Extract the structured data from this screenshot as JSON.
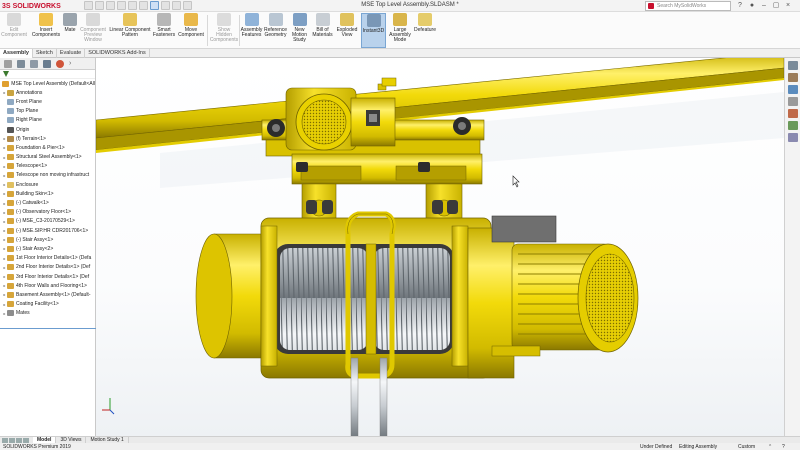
{
  "app": {
    "brand": "SOLIDWORKS",
    "logo_glyph": "3S"
  },
  "title_bar": {
    "document_title": "MSE Top Level Assembly.SLDASM *",
    "search_placeholder": "Search MySolidWorks",
    "icons": [
      "help-icon",
      "user-icon",
      "minimize-icon",
      "restore-icon",
      "close-icon"
    ]
  },
  "ribbon": {
    "commands": [
      {
        "label": "Edit\nComponent",
        "enabled": false,
        "icon": "edit-component-icon"
      },
      {
        "label": "Insert\nComponents",
        "enabled": true,
        "icon": "insert-components-icon"
      },
      {
        "label": "Mate",
        "enabled": true,
        "icon": "mate-icon"
      },
      {
        "label": "Component\nPreview\nWindow",
        "enabled": false,
        "icon": "preview-window-icon"
      },
      {
        "label": "Linear Component\nPattern",
        "enabled": true,
        "icon": "linear-pattern-icon"
      },
      {
        "label": "Smart\nFasteners",
        "enabled": true,
        "icon": "smart-fasteners-icon"
      },
      {
        "label": "Move\nComponent",
        "enabled": true,
        "icon": "move-component-icon"
      },
      {
        "label": "Show\nHidden\nComponents",
        "enabled": false,
        "icon": "show-hidden-icon"
      },
      {
        "label": "Assembly\nFeatures",
        "enabled": true,
        "icon": "assembly-features-icon"
      },
      {
        "label": "Reference\nGeometry",
        "enabled": true,
        "icon": "reference-geometry-icon"
      },
      {
        "label": "New\nMotion\nStudy",
        "enabled": true,
        "icon": "motion-study-icon"
      },
      {
        "label": "Bill of\nMaterials",
        "enabled": true,
        "icon": "bom-icon"
      },
      {
        "label": "Exploded\nView",
        "enabled": true,
        "icon": "exploded-view-icon"
      },
      {
        "label": "Instant3D",
        "enabled": true,
        "active": true,
        "icon": "instant3d-icon"
      },
      {
        "label": "Large\nAssembly\nMode",
        "enabled": true,
        "icon": "large-assembly-icon"
      },
      {
        "label": "Defeature",
        "enabled": true,
        "icon": "defeature-icon"
      }
    ]
  },
  "tabs": [
    "Assembly",
    "Sketch",
    "Evaluate",
    "SOLIDWORKS Add-Ins"
  ],
  "active_tab": "Assembly",
  "tree": {
    "items": [
      {
        "label": "MSE Top Level Assembly  (Default<All",
        "icon": "assembly-icon",
        "expand": ""
      },
      {
        "label": "Annotations",
        "icon": "annotations-icon",
        "expand": "▸"
      },
      {
        "label": "Front Plane",
        "icon": "plane-icon",
        "expand": ""
      },
      {
        "label": "Top Plane",
        "icon": "plane-icon",
        "expand": ""
      },
      {
        "label": "Right Plane",
        "icon": "plane-icon",
        "expand": ""
      },
      {
        "label": "Origin",
        "icon": "origin-icon",
        "expand": ""
      },
      {
        "label": "(f) Terrain<1>",
        "icon": "part-icon",
        "expand": "▸"
      },
      {
        "label": "Foundation & Pier<1>",
        "icon": "subassembly-icon",
        "expand": "▸"
      },
      {
        "label": "Structural Steel Assembly<1>",
        "icon": "subassembly-icon",
        "expand": "▸"
      },
      {
        "label": "Telescope<1>",
        "icon": "subassembly-icon",
        "expand": "▸"
      },
      {
        "label": "Telescope non moving infrastruct",
        "icon": "subassembly-icon",
        "expand": "▸"
      },
      {
        "label": "Enclosure",
        "icon": "folder-icon",
        "expand": "▸"
      },
      {
        "label": "Building Skin<1>",
        "icon": "subassembly-icon",
        "expand": "▸"
      },
      {
        "label": "(-) Catwalk<1>",
        "icon": "subassembly-icon",
        "expand": "▸"
      },
      {
        "label": "(-) Observatory Floor<1>",
        "icon": "subassembly-icon",
        "expand": "▸"
      },
      {
        "label": "(-) MSE_C3-20170529<1>",
        "icon": "subassembly-icon",
        "expand": "▸"
      },
      {
        "label": "(-) MSE.SIP.HR CDR201706<1>",
        "icon": "subassembly-icon",
        "expand": "▸"
      },
      {
        "label": "(-) Stair Assy<1>",
        "icon": "subassembly-icon",
        "expand": "▸"
      },
      {
        "label": "(-) Stair Assy<2>",
        "icon": "subassembly-icon",
        "expand": "▸"
      },
      {
        "label": "1st Floor Interior Details<1> (Defa",
        "icon": "subassembly-icon",
        "expand": "▸"
      },
      {
        "label": "2nd Floor Interior Details<1> (Def",
        "icon": "subassembly-icon",
        "expand": "▸"
      },
      {
        "label": "3rd Floor Interior Details<1> (Def",
        "icon": "subassembly-icon",
        "expand": "▸"
      },
      {
        "label": "4th Floor Walls and Flooring<1>",
        "icon": "subassembly-icon",
        "expand": "▸"
      },
      {
        "label": "Basement Assembly<1> (Default-",
        "icon": "subassembly-icon",
        "expand": "▸"
      },
      {
        "label": "Coating Facility<1>",
        "icon": "subassembly-icon",
        "expand": "▸"
      },
      {
        "label": "Mates",
        "icon": "mates-icon",
        "expand": "▸"
      }
    ]
  },
  "bottom_tabs": [
    "Model",
    "3D Views",
    "Motion Study 1"
  ],
  "active_bottom_tab": "Model",
  "status": {
    "product": "SOLIDWORKS Premium 2019",
    "state": "Under Defined",
    "mode": "Editing Assembly",
    "units": "Custom"
  },
  "colors": {
    "part_yellow": "#f5df0c",
    "part_yellow_dark": "#a89300",
    "accent_red": "#c8102e",
    "instant3d_active": "#b9d2ec"
  }
}
